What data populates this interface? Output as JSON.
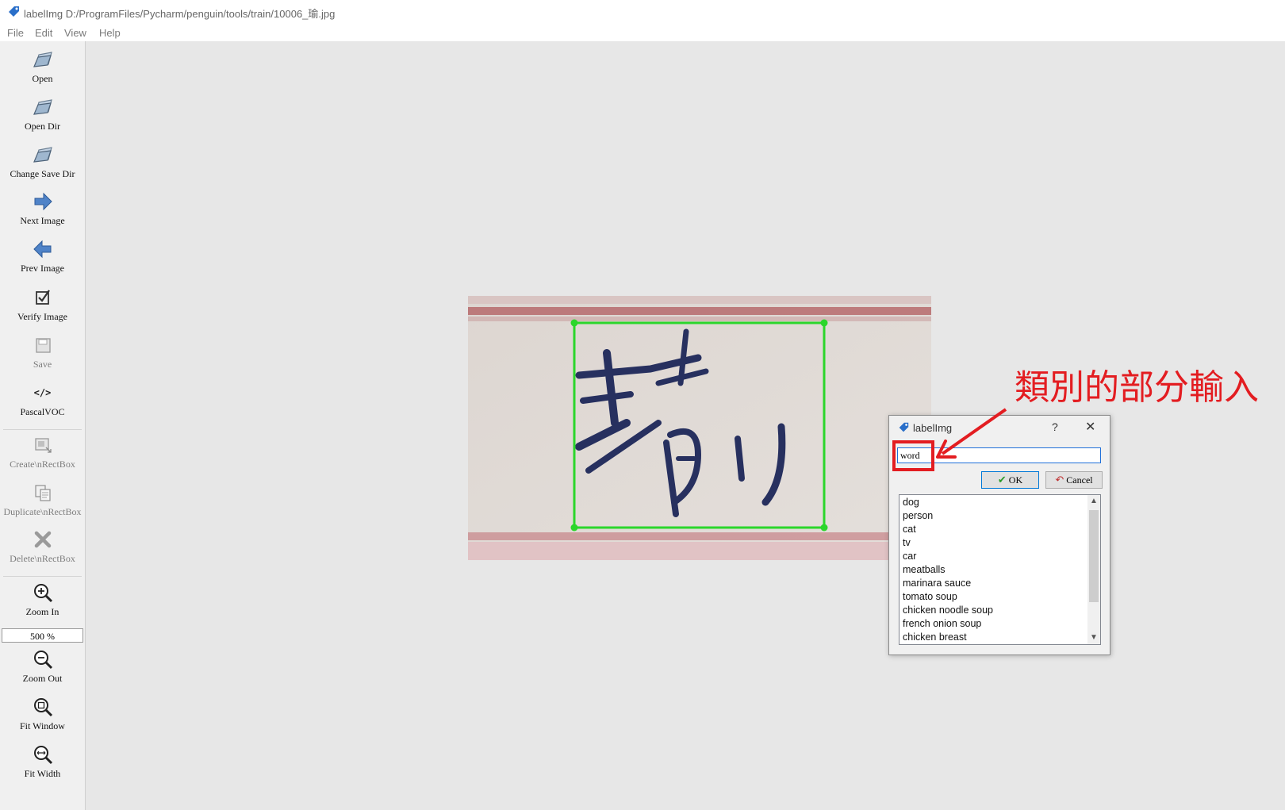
{
  "window": {
    "title": "labelImg D:/ProgramFiles/Pycharm/penguin/tools/train/10006_瑜.jpg"
  },
  "menu": [
    "File",
    "Edit",
    "View",
    "Help"
  ],
  "toolbar": {
    "open": "Open",
    "open_dir": "Open Dir",
    "change_save_dir": "Change Save Dir",
    "next_image": "Next Image",
    "prev_image": "Prev Image",
    "verify_image": "Verify Image",
    "save": "Save",
    "format": "PascalVOC",
    "create_rectbox": "Create\\nRectBox",
    "duplicate_rectbox": "Duplicate\\nRectBox",
    "delete_rectbox": "Delete\\nRectBox",
    "zoom_in": "Zoom In",
    "zoom_value": "500 %",
    "zoom_out": "Zoom Out",
    "fit_window": "Fit Window",
    "fit_width": "Fit Width",
    "format_glyph": "</>"
  },
  "annotation": {
    "text": "類別的部分輸入",
    "word": "word"
  },
  "dialog": {
    "title": "labelImg",
    "help_glyph": "?",
    "close_glyph": "✕",
    "input_value": "word",
    "ok_label": "OK",
    "cancel_label": "Cancel",
    "labels": [
      "dog",
      "person",
      "cat",
      "tv",
      "car",
      "meatballs",
      "marinara sauce",
      "tomato soup",
      "chicken noodle soup",
      "french onion soup",
      "chicken breast"
    ]
  },
  "colors": {
    "bbox": "#2bd62b",
    "annotation": "#e31d21"
  }
}
